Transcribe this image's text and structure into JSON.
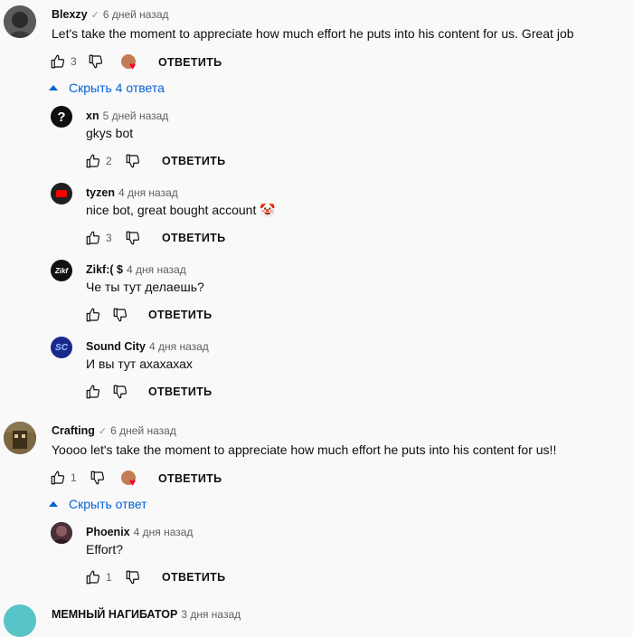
{
  "reply_label": "ОТВЕТИТЬ",
  "threads": [
    {
      "author": "Blexzy",
      "time": "6 дней назад",
      "text": "Let's take the moment to appreciate how much effort he puts into his content for us. Great job",
      "likes": "3",
      "toggle": "Скрыть 4 ответа",
      "replies": [
        {
          "author": "xn",
          "time": "5 дней назад",
          "text": "gkys bot",
          "likes": "2"
        },
        {
          "author": "tyzen",
          "time": "4 дня назад",
          "text": "nice bot, great bought account 🤡",
          "likes": "3"
        },
        {
          "author": "Zikf:( $",
          "time": "4 дня назад",
          "text": "Че ты тут делаешь?",
          "likes": ""
        },
        {
          "author": "Sound City",
          "time": "4 дня назад",
          "text": "И вы тут ахахахах",
          "likes": ""
        }
      ]
    },
    {
      "author": "Crafting",
      "time": "6 дней назад",
      "text": "Yoooo let's take the moment to appreciate how much effort he puts into his content for us!!",
      "likes": "1",
      "toggle": "Скрыть ответ",
      "replies": [
        {
          "author": "Phoenix",
          "time": "4 дня назад",
          "text": "Effort?",
          "likes": "1"
        }
      ]
    }
  ],
  "next_comment": {
    "author": "МЕМНЫЙ НАГИБАТОР",
    "time": "3 дня назад"
  },
  "colors": {
    "link": "#065fd4",
    "background": "#f9f9f9"
  }
}
